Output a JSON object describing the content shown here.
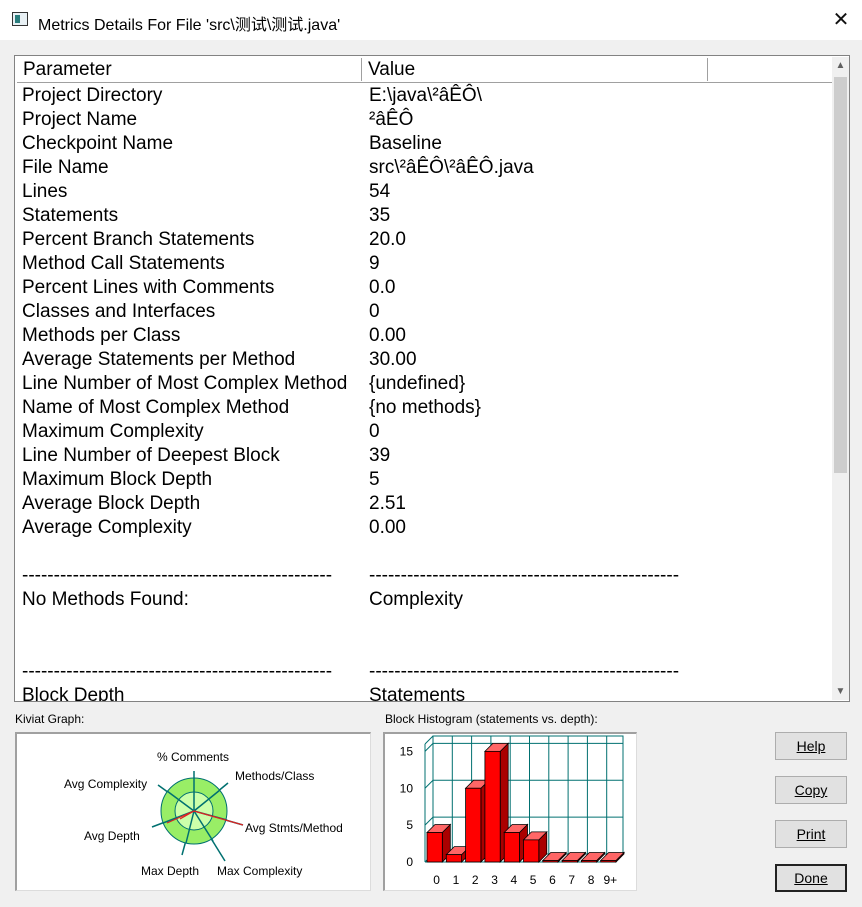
{
  "window": {
    "title": "Metrics Details For File 'src\\测试\\测试.java'"
  },
  "table": {
    "columns": [
      "Parameter",
      "Value"
    ],
    "rows": [
      [
        "Project Directory",
        "E:\\java\\²âÊÔ\\"
      ],
      [
        "Project Name",
        "²âÊÔ"
      ],
      [
        "Checkpoint Name",
        "Baseline"
      ],
      [
        "File Name",
        "src\\²âÊÔ\\²âÊÔ.java"
      ],
      [
        "Lines",
        "54"
      ],
      [
        "Statements",
        "35"
      ],
      [
        "Percent Branch Statements",
        "20.0"
      ],
      [
        "Method Call Statements",
        "9"
      ],
      [
        "Percent Lines with Comments",
        "0.0"
      ],
      [
        "Classes and Interfaces",
        "0"
      ],
      [
        "Methods per Class",
        "0.00"
      ],
      [
        "Average Statements per Method",
        "30.00"
      ],
      [
        "Line Number of Most Complex Method",
        "{undefined}"
      ],
      [
        "Name of Most Complex Method",
        "{no methods}"
      ],
      [
        "Maximum Complexity",
        "0"
      ],
      [
        "Line Number of Deepest Block",
        "39"
      ],
      [
        "Maximum Block Depth",
        "5"
      ],
      [
        "Average Block Depth",
        "2.51"
      ],
      [
        "Average Complexity",
        "0.00"
      ],
      [
        "",
        ""
      ],
      [
        "-------------------------------------------------",
        "-------------------------------------------------"
      ],
      [
        "No Methods Found:",
        "Complexity"
      ],
      [
        "",
        ""
      ],
      [
        "",
        ""
      ],
      [
        "-------------------------------------------------",
        "-------------------------------------------------"
      ],
      [
        "Block Depth",
        "Statements"
      ]
    ]
  },
  "kiviat": {
    "label": "Kiviat Graph:",
    "axes": [
      "% Comments",
      "Methods/Class",
      "Avg Stmts/Method",
      "Max Complexity",
      "Max Depth",
      "Avg Depth",
      "Avg Complexity"
    ]
  },
  "histogram": {
    "label": "Block Histogram (statements vs. depth):"
  },
  "chart_data": {
    "type": "bar",
    "categories": [
      "0",
      "1",
      "2",
      "3",
      "4",
      "5",
      "6",
      "7",
      "8",
      "9+"
    ],
    "values": [
      4,
      1,
      10,
      15,
      4,
      3,
      0,
      0,
      0,
      0
    ],
    "ylim": [
      0,
      16
    ],
    "yticks": [
      "0",
      "5",
      "10",
      "15"
    ],
    "grid": true,
    "bar_color": "#ff0000"
  },
  "buttons": {
    "help": "Help",
    "copy": "Copy",
    "print": "Print",
    "done": "Done"
  },
  "colors": {
    "kiviat_ring": "#99ee66",
    "kiviat_inner": "#ccffaa",
    "grid": "#007070",
    "bar": "#ff0000"
  }
}
